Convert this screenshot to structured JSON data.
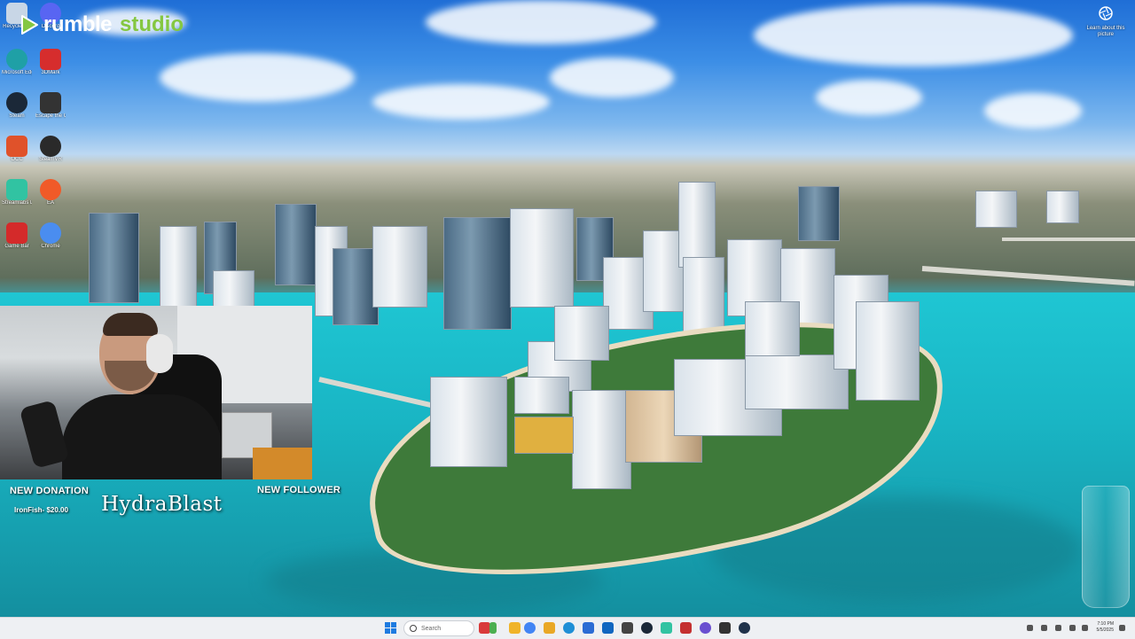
{
  "overlay": {
    "brand": "rumble",
    "brand_suffix": "studio",
    "brand_color": "#85c742"
  },
  "desktop": {
    "icons": [
      {
        "label": "Recycle Bin",
        "icon": "recycle-bin-icon",
        "color": "#c8d6e6"
      },
      {
        "label": "Discord",
        "icon": "discord-icon",
        "color": "#5865f2"
      },
      {
        "label": "Microsoft Edge",
        "icon": "edge-icon",
        "color": "#1fa0a6"
      },
      {
        "label": "3DMark",
        "icon": "3dmark-icon",
        "color": "#d62d2d"
      },
      {
        "label": "Steam",
        "icon": "steam-icon",
        "color": "#1b2838"
      },
      {
        "label": "Escape the Games",
        "icon": "game-icon",
        "color": "#333333"
      },
      {
        "label": "OCC",
        "icon": "occ-icon",
        "color": "#e0522a"
      },
      {
        "label": "SteamVR",
        "icon": "steamvr-icon",
        "color": "#2a2a2a"
      },
      {
        "label": "Streamlabs Desktop",
        "icon": "streamlabs-icon",
        "color": "#31c3a2"
      },
      {
        "label": "EA",
        "icon": "ea-icon",
        "color": "#f05a28"
      },
      {
        "label": "Game Bar",
        "icon": "gamebar-icon",
        "color": "#d42a2a"
      },
      {
        "label": "Chrome",
        "icon": "chrome-icon",
        "color": "#4a8df0"
      }
    ],
    "learn_about": "Learn about this picture"
  },
  "alerts": {
    "new_donation_label": "NEW DONATION",
    "donation_detail": "IronFish- $20.00",
    "new_follower_label": "NEW FOLLOWER",
    "follower_name": "HydraBlast"
  },
  "taskbar": {
    "search_placeholder": "Search",
    "apps": [
      {
        "icon": "copilot-icon",
        "color": "#d93a3a"
      },
      {
        "icon": "file-explorer-icon",
        "color": "#f0b429"
      },
      {
        "icon": "chrome-icon",
        "color": "#4285f4"
      },
      {
        "icon": "folder-icon",
        "color": "#e9a826"
      },
      {
        "icon": "edge-icon",
        "color": "#1f8fd6"
      },
      {
        "icon": "store-icon",
        "color": "#2b6cd4"
      },
      {
        "icon": "outlook-icon",
        "color": "#1066c0"
      },
      {
        "icon": "app-icon",
        "color": "#444444"
      },
      {
        "icon": "steam-icon",
        "color": "#1b2838"
      },
      {
        "icon": "streamlabs-icon",
        "color": "#31c3a2"
      },
      {
        "icon": "game-icon",
        "color": "#c43030"
      },
      {
        "icon": "obs-icon",
        "color": "#6a4fd0"
      },
      {
        "icon": "terminal-icon",
        "color": "#333333"
      },
      {
        "icon": "steam-icon",
        "color": "#20324a"
      }
    ],
    "clock_time": "7:10 PM",
    "clock_date": "5/5/2025"
  }
}
